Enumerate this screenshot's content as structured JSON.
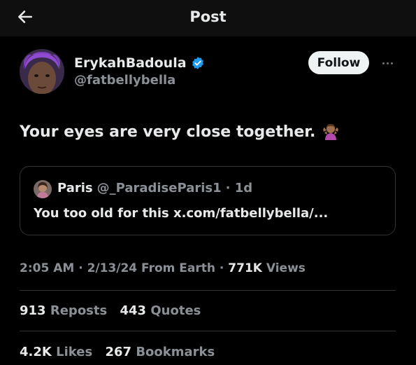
{
  "header": {
    "title": "Post",
    "back_icon": "arrow-left-icon"
  },
  "author": {
    "display_name": "ErykahBadoula",
    "handle": "@fatbellybella",
    "verified_icon": "verified-badge-icon",
    "verified_color": "#1d9bf0"
  },
  "follow_label": "Follow",
  "more_icon": "more-horizontal-icon",
  "tweet": {
    "text": "Your eyes are very close together.",
    "emoji": "🤷🏽‍♀️",
    "emoji_icon": "shrug-emoji-icon"
  },
  "quote": {
    "name": "Paris",
    "handle": "@_ParadiseParis1",
    "time": "· 1d",
    "text": "You too old for this x.com/fatbellybella/..."
  },
  "meta": {
    "time": "2:05 AM",
    "date": "· 2/13/24 From Earth ·",
    "views_count": "771K",
    "views_label": "Views"
  },
  "stats": {
    "reposts_count": "913",
    "reposts_label": "Reposts",
    "quotes_count": "443",
    "quotes_label": "Quotes",
    "likes_count": "4.2K",
    "likes_label": "Likes",
    "bookmarks_count": "267",
    "bookmarks_label": "Bookmarks"
  },
  "colors": {
    "background": "#000000",
    "text_primary": "#e7e9ea",
    "text_secondary": "#8b9097",
    "follow_button_bg": "#eff3f4",
    "border": "#2f3336"
  }
}
